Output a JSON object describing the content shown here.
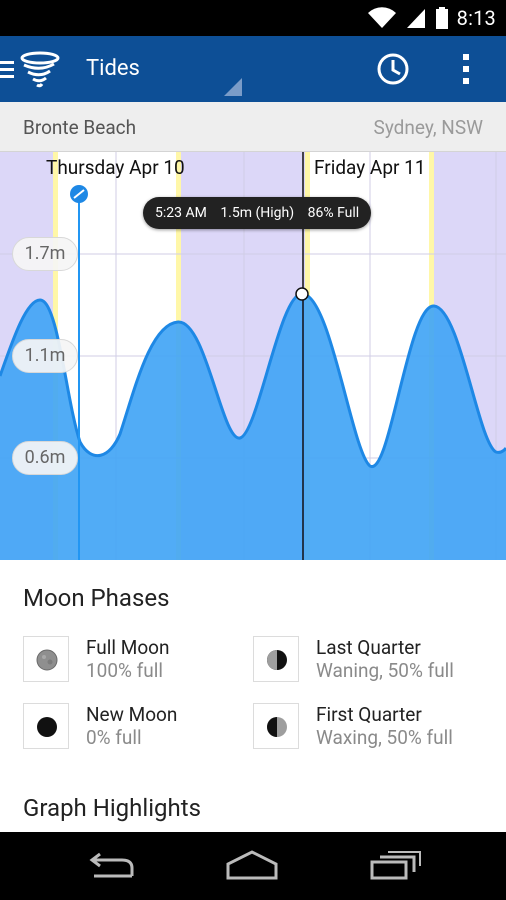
{
  "status_bar": {
    "time": "8:13",
    "icons": [
      "wifi-icon",
      "signal-icon",
      "battery-icon"
    ]
  },
  "app_bar": {
    "title": "Tides",
    "actions": [
      "clock-icon",
      "overflow-menu-icon"
    ],
    "logo": "cyclone-logo-icon"
  },
  "location": {
    "name": "Bronte Beach",
    "region": "Sydney, NSW"
  },
  "chart": {
    "days": [
      "Thursday Apr 10",
      "Friday Apr 11"
    ],
    "y_labels": [
      "1.7m",
      "1.1m",
      "0.6m"
    ],
    "tooltip": {
      "time": "5:23 AM",
      "height": "1.5m (High)",
      "moon": "86% Full"
    }
  },
  "chart_data": {
    "type": "area",
    "title": "",
    "ylabel": "",
    "yticks": [
      "1.7m",
      "1.1m",
      "0.6m"
    ],
    "x_day_labels": [
      "Thursday Apr 10",
      "Friday Apr 11"
    ],
    "series": [
      {
        "name": "",
        "points": [
          {
            "x": 0,
            "y": 1.1
          },
          {
            "x": 40,
            "y": 1.45
          },
          {
            "x": 80,
            "y": 0.6
          },
          {
            "x": 178,
            "y": 1.32
          },
          {
            "x": 240,
            "y": 0.72
          },
          {
            "x": 302,
            "y": 1.5
          },
          {
            "x": 370,
            "y": 0.5
          },
          {
            "x": 434,
            "y": 1.45
          },
          {
            "x": 496,
            "y": 0.6
          },
          {
            "x": 506,
            "y": 0.65
          }
        ]
      }
    ],
    "highlight": {
      "time": "5:23 AM",
      "value": "1.5m (High)",
      "moon": "86% Full"
    }
  },
  "moon_phases": {
    "title": "Moon Phases",
    "items": [
      {
        "name": "Full Moon",
        "desc": "100% full",
        "icon": "full-moon-icon"
      },
      {
        "name": "Last Quarter",
        "desc": "Waning, 50% full",
        "icon": "last-quarter-icon"
      },
      {
        "name": "New Moon",
        "desc": "0% full",
        "icon": "new-moon-icon"
      },
      {
        "name": "First Quarter",
        "desc": "Waxing, 50% full",
        "icon": "first-quarter-icon"
      }
    ]
  },
  "graph_highlights": {
    "title": "Graph Highlights"
  },
  "colors": {
    "app_bar": "#0d4f96",
    "night": "#dcd7f8",
    "water": "#42a5f5",
    "water_line": "#1e88e5",
    "sun": "#fff7a8"
  }
}
